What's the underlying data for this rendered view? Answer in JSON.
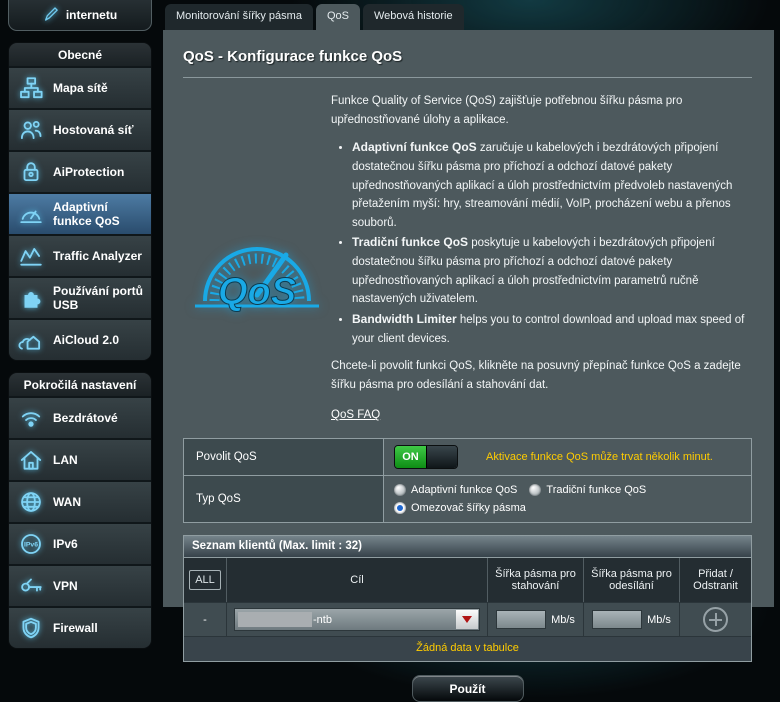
{
  "sidebar": {
    "top_button_label": "internetu",
    "sections": [
      {
        "title": "Obecné",
        "items": [
          {
            "label": "Mapa sítě",
            "icon": "network-map-icon",
            "active": false
          },
          {
            "label": "Hostovaná síť",
            "icon": "guest-network-icon",
            "active": false
          },
          {
            "label": "AiProtection",
            "icon": "shield-lock-icon",
            "active": false
          },
          {
            "label": "Adaptivní funkce QoS",
            "icon": "gauge-icon",
            "active": true
          },
          {
            "label": "Traffic Analyzer",
            "icon": "traffic-chart-icon",
            "active": false
          },
          {
            "label": "Používání portů USB",
            "icon": "usb-puzzle-icon",
            "active": false
          },
          {
            "label": "AiCloud 2.0",
            "icon": "cloud-home-icon",
            "active": false
          }
        ]
      },
      {
        "title": "Pokročilá nastavení",
        "items": [
          {
            "label": "Bezdrátové",
            "icon": "wifi-icon",
            "active": false
          },
          {
            "label": "LAN",
            "icon": "home-icon",
            "active": false
          },
          {
            "label": "WAN",
            "icon": "globe-icon",
            "active": false
          },
          {
            "label": "IPv6",
            "icon": "ipv6-icon",
            "active": false
          },
          {
            "label": "VPN",
            "icon": "vpn-icon",
            "active": false
          },
          {
            "label": "Firewall",
            "icon": "firewall-shield-icon",
            "active": false
          }
        ]
      }
    ]
  },
  "tabs": [
    {
      "label": "Monitorování šířky pásma",
      "active": false
    },
    {
      "label": "QoS",
      "active": true
    },
    {
      "label": "Webová historie",
      "active": false
    }
  ],
  "page": {
    "title": "QoS - Konfigurace funkce QoS",
    "gauge_text": "QoS",
    "intro": "Funkce Quality of Service (QoS) zajišťuje potřebnou šířku pásma pro upřednostňované úlohy a aplikace.",
    "bullets": [
      {
        "lead": "Adaptivní funkce QoS",
        "text": " zaručuje u kabelových i bezdrátových připojení dostatečnou šířku pásma pro příchozí a odchozí datové pakety upřednostňovaných aplikací a úloh prostřednictvím předvoleb nastavených přetažením myší: hry, streamování médií, VoIP, procházení webu a přenos souborů."
      },
      {
        "lead": "Tradiční funkce QoS",
        "text": " poskytuje u kabelových i bezdrátových připojení dostatečnou šířku pásma pro příchozí a odchozí datové pakety upřednostňovaných aplikací a úloh prostřednictvím parametrů ručně nastavených uživatelem."
      },
      {
        "lead": "Bandwidth Limiter",
        "text": " helps you to control download and upload max speed of your client devices."
      }
    ],
    "outro": "Chcete-li povolit funkci QoS, klikněte na posuvný přepínač funkce QoS a zadejte šířku pásma pro odesílání a stahování dat.",
    "faq_link": "QoS FAQ"
  },
  "settings": {
    "enable_label": "Povolit QoS",
    "toggle_state": "ON",
    "warning": "Aktivace funkce QoS může trvat několik minut.",
    "type_label": "Typ QoS",
    "radio_options": [
      {
        "label": "Adaptivní funkce QoS",
        "selected": false
      },
      {
        "label": "Tradiční funkce QoS",
        "selected": false
      },
      {
        "label": "Omezovač šířky pásma",
        "selected": true
      }
    ]
  },
  "client_table": {
    "title": "Seznam klientů (Max. limit : 32)",
    "all_button": "ALL",
    "columns": [
      "Cíl",
      "Šířka pásma pro stahování",
      "Šířka pásma pro odesílání",
      "Přidat / Odstranit"
    ],
    "row": {
      "index": "-",
      "target_value": "-ntb",
      "download_value": "",
      "download_unit": "Mb/s",
      "upload_value": "",
      "upload_unit": "Mb/s"
    },
    "empty_text": "Žádná data v tabulce"
  },
  "apply_button": "Použít",
  "colors": {
    "accent_cyan": "#19a9e6",
    "warning_yellow": "#ffcc00",
    "toggle_green": "#149b1b",
    "panel_gray": "#4d595d",
    "active_nav_blue": "#3a638c",
    "dropdown_arrow_red": "#b01414"
  }
}
